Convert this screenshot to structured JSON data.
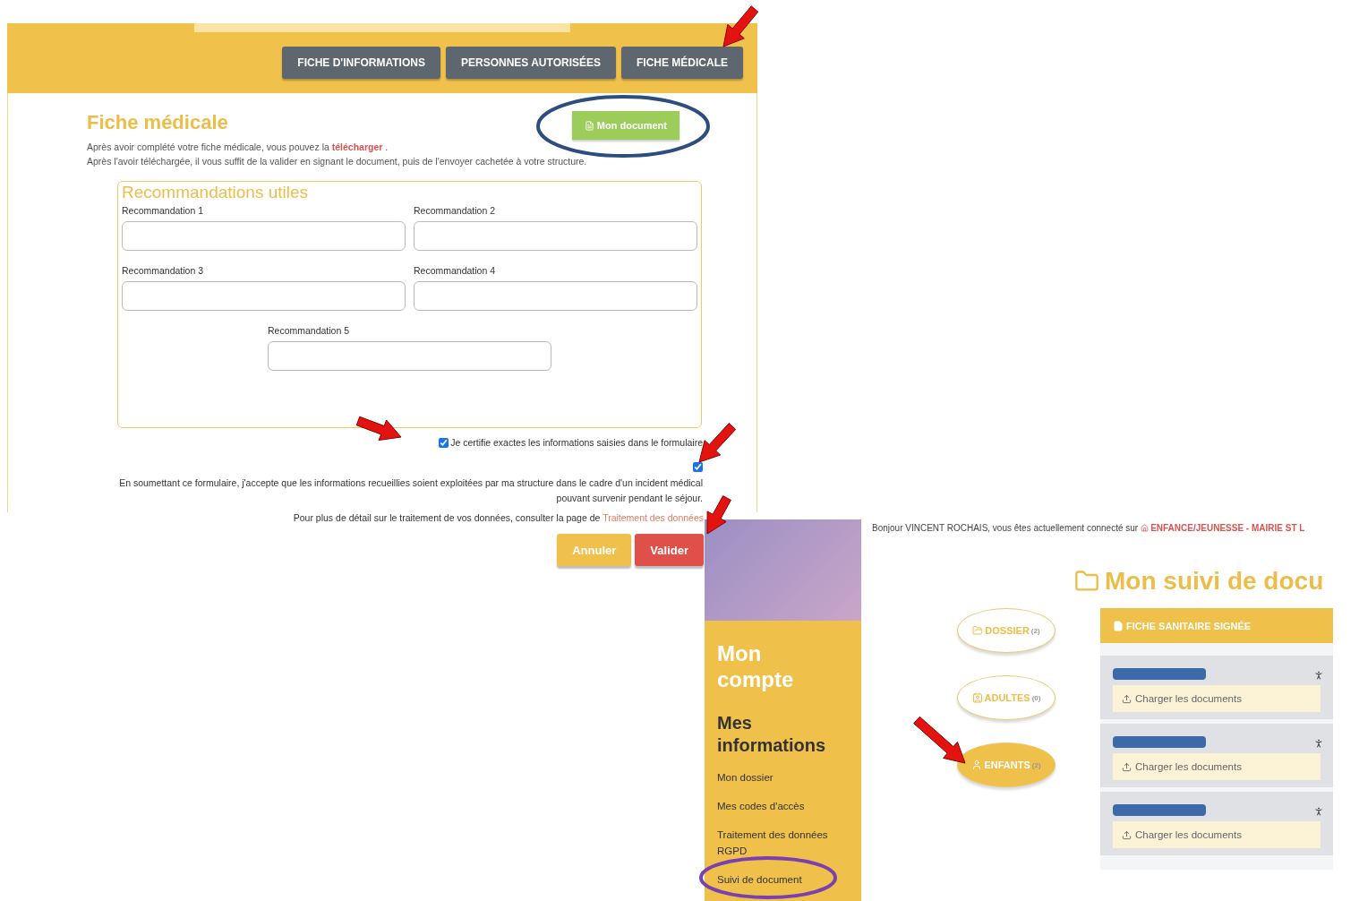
{
  "form_screen": {
    "tabs": [
      {
        "label": "FICHE D'INFORMATIONS"
      },
      {
        "label": "PERSONNES AUTORISÉES"
      },
      {
        "label": "FICHE MÉDICALE"
      }
    ],
    "title": "Fiche médicale",
    "document_button": "Mon document",
    "intro": [
      "Après avoir complété votre fiche médicale, vous pouvez la **télécharger** .",
      "Après l'avoir téléchargée, il vous suffit de la valider en signant le document, puis de l'envoyer cachetée à votre structure."
    ],
    "legend": "Recommandations utiles",
    "fields": [
      {
        "label": "Recommandation 1"
      },
      {
        "label": "Recommandation 2"
      },
      {
        "label": "Recommandation 3"
      },
      {
        "label": "Recommandation 4"
      },
      {
        "label": "Recommandation 5"
      }
    ],
    "certify": {
      "label": "Je certifie exactes les informations saisies dans le formulaire",
      "checked": true
    },
    "consent": {
      "checked": true,
      "text": "En soumettant ce formulaire, j'accepte que les informations recueillies soient exploitées par ma structure dans le cadre d'un incident médical pouvant survenir pendant le séjour."
    },
    "privacy_text": "Pour plus de détail sur le traitement de vos données, consulter la page de",
    "privacy_link": "Traitement des données",
    "buttons": [
      "Annuler",
      "Valider"
    ]
  },
  "account_screen": {
    "greeting": "Bonjour VINCENT ROCHAIS, vous êtes actuellement connecté sur",
    "site": "ENFANCE/JEUNESSE - MAIRIE ST L",
    "sidebar": {
      "title": "Mon compte",
      "section": "Mes informations",
      "items": [
        {
          "label": "Mon dossier"
        },
        {
          "label": "Mes codes d'accès"
        },
        {
          "label": "Traitement des données RGPD"
        },
        {
          "label": "Suivi de document"
        }
      ]
    },
    "page_title": "Mon suivi de docu",
    "categories": [
      {
        "kind": "folder",
        "label": "DOSSIER",
        "count": "(2)",
        "selected": false
      },
      {
        "kind": "adult",
        "label": "ADULTES",
        "count": "(0)",
        "selected": false
      },
      {
        "kind": "child",
        "label": "ENFANTS",
        "count": "(2)",
        "selected": true
      }
    ],
    "panel_title": "FICHE SANITAIRE SIGNÉE",
    "documents": [
      {
        "action": "Charger les documents"
      },
      {
        "action": "Charger les documents"
      },
      {
        "action": "Charger les documents"
      }
    ]
  }
}
